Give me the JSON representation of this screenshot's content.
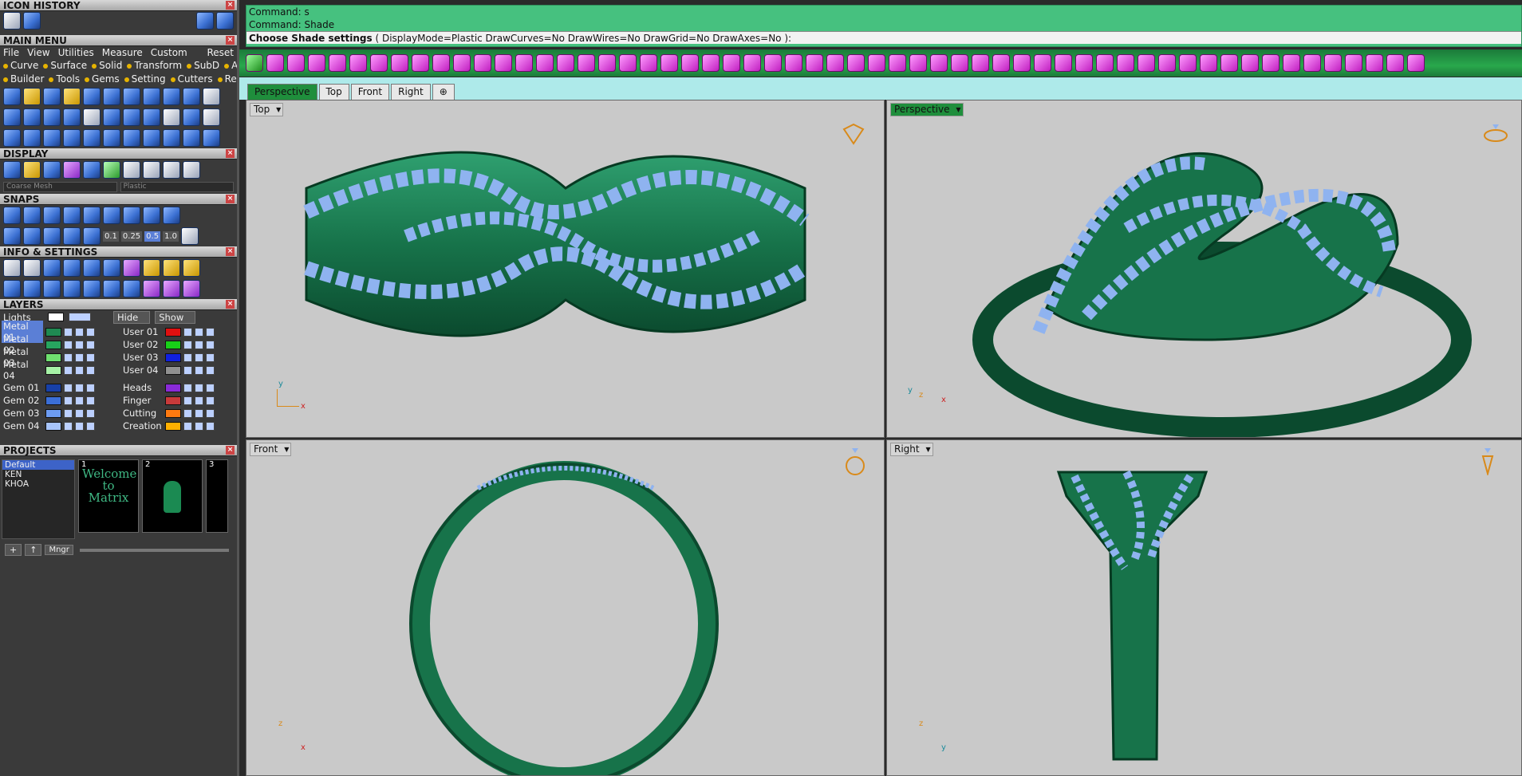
{
  "panels": {
    "icon_history": "ICON HISTORY",
    "main_menu": "MAIN MENU",
    "display": "DISPLAY",
    "snaps": "SNAPS",
    "info_settings": "INFO & SETTINGS",
    "layers": "LAYERS",
    "projects": "PROJECTS"
  },
  "menu": [
    "File",
    "View",
    "Utilities",
    "Measure",
    "Custom"
  ],
  "menu_reset": "Reset",
  "categories_row1": [
    "Curve",
    "Surface",
    "Solid",
    "Transform",
    "SubD",
    "Art"
  ],
  "categories_row2": [
    "Builder",
    "Tools",
    "Gems",
    "Setting",
    "Cutters",
    "Render"
  ],
  "display_selects": {
    "mesh": "Coarse Mesh",
    "material": "Plastic"
  },
  "snap_values": [
    "0.1",
    "0.25",
    "0.5",
    "1.0"
  ],
  "layers_header": {
    "lights": "Lights",
    "hide": "Hide",
    "show": "Show"
  },
  "layers_left": [
    {
      "name": "Metal 01",
      "color": "#1f8a52",
      "selected": true
    },
    {
      "name": "Metal 02",
      "color": "#27a55f"
    },
    {
      "name": "Metal 03",
      "color": "#6fe06f"
    },
    {
      "name": "Metal 04",
      "color": "#a6f2a6"
    },
    {
      "name": "Gem 01",
      "color": "#1740a8"
    },
    {
      "name": "Gem 02",
      "color": "#3b6fd8"
    },
    {
      "name": "Gem 03",
      "color": "#6d9cf2"
    },
    {
      "name": "Gem 04",
      "color": "#a7c4fa"
    }
  ],
  "layers_right": [
    {
      "name": "User 01",
      "color": "#e01010"
    },
    {
      "name": "User 02",
      "color": "#18d018"
    },
    {
      "name": "User 03",
      "color": "#1020e0"
    },
    {
      "name": "User 04",
      "color": "#909090"
    },
    {
      "name": "Heads",
      "color": "#8a2bd8"
    },
    {
      "name": "Finger",
      "color": "#c83a3a"
    },
    {
      "name": "Cutting",
      "color": "#ff7a10"
    },
    {
      "name": "Creation",
      "color": "#ffb000"
    }
  ],
  "projects": {
    "list": [
      "Default",
      "KEN",
      "KHOA"
    ],
    "thumbs": [
      {
        "num": "1",
        "text": "Welcome to Matrix"
      },
      {
        "num": "2",
        "text": ""
      },
      {
        "num": "3",
        "text": ""
      }
    ],
    "mngr": "Mngr"
  },
  "command": {
    "line1": "Command: s",
    "line2": "Command: Shade",
    "line3_bold": "Choose Shade settings",
    "line3_rest": " ( DisplayMode=Plastic  DrawCurves=No  DrawWires=No  DrawGrid=No  DrawAxes=No ):"
  },
  "tabs": [
    "Perspective",
    "Top",
    "Front",
    "Right"
  ],
  "active_tab": "Perspective",
  "viewports": {
    "top": "Top",
    "perspective": "Perspective",
    "front": "Front",
    "right": "Right"
  },
  "axes": {
    "x": "x",
    "y": "y",
    "z": "z"
  },
  "colors": {
    "metal": "#17734a",
    "gem": "#8fb3f0",
    "axis_red": "#cc2222",
    "axis_orange": "#d98a1a"
  }
}
